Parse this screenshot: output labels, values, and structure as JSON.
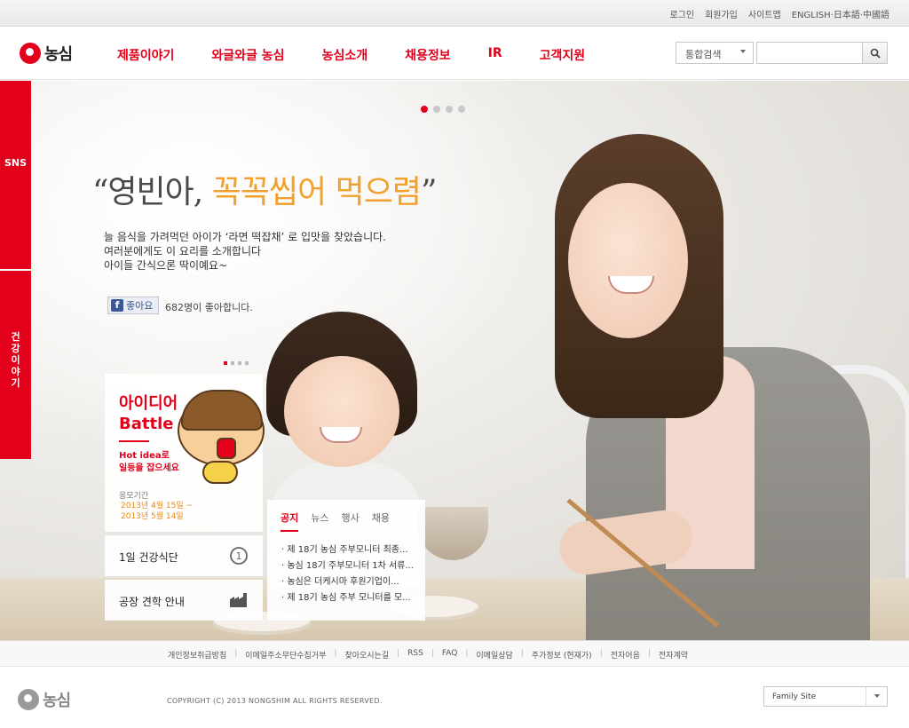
{
  "utility": [
    "로그인",
    "회원가입",
    "사이트맵",
    "ENGLISH·日本語·中國語"
  ],
  "brand": "농심",
  "nav": [
    "제품이야기",
    "와글와글 농심",
    "농심소개",
    "채용정보",
    "IR",
    "고객지원"
  ],
  "search": {
    "select": "통합검색",
    "placeholder": ""
  },
  "hero": {
    "quote_open": "“영빈아, ",
    "quote_highlight": "꼭꼭씹어 먹으렴",
    "quote_close": "”",
    "lines": [
      "늘 음식을 가려먹던 아이가 ‘라면 떡잡채’ 로 입맛을 찾았습니다.",
      "여러분에게도 이 요리를 소개합니다",
      "아이들 간식으론 딱이예요~"
    ],
    "like_label": "좋아요",
    "like_count": "682명이 좋아합니다."
  },
  "side_tabs": {
    "sns": "SNS",
    "health": "건강이야기"
  },
  "idea_battle": {
    "title_line1": "아이디어",
    "title_line2": "Battle",
    "sub_line1": "Hot idea로",
    "sub_line2": "일등을 잡으세요",
    "period_label": "응모기간",
    "period_start": "2013년 4월 15일 ~",
    "period_end": "2013년 5월 14일"
  },
  "side_links": {
    "health_menu": "1일 건강식단",
    "factory_tour": "공장 견학 안내",
    "health_badge": "1"
  },
  "news": {
    "tabs": [
      "공지",
      "뉴스",
      "행사",
      "채용"
    ],
    "items": [
      "· 제 18기 농심 주부모니터 최종...",
      "· 농심 18기 주부모니터 1차 서류...",
      "· 농심은 더케시마 후원기업이...",
      "· 제 18기 농심 주부 모니터를 모..."
    ]
  },
  "footer": {
    "links": [
      "개인정보취급방침",
      "이메일주소무단수집거부",
      "찾아오시는길",
      "RSS",
      "FAQ",
      "이메일상담",
      "주가정보 (현재가)",
      "전자어음",
      "전자계약"
    ],
    "copyright": "COPYRIGHT (C) 2013 NONGSHIM ALL RIGHTS RESERVED.",
    "family_site": "Family Site"
  },
  "colors": {
    "brand_red": "#e3001b",
    "highlight_orange": "#f2a02e"
  },
  "icons": [
    "search-icon",
    "facebook-icon",
    "chevron-down-icon",
    "factory-icon"
  ]
}
